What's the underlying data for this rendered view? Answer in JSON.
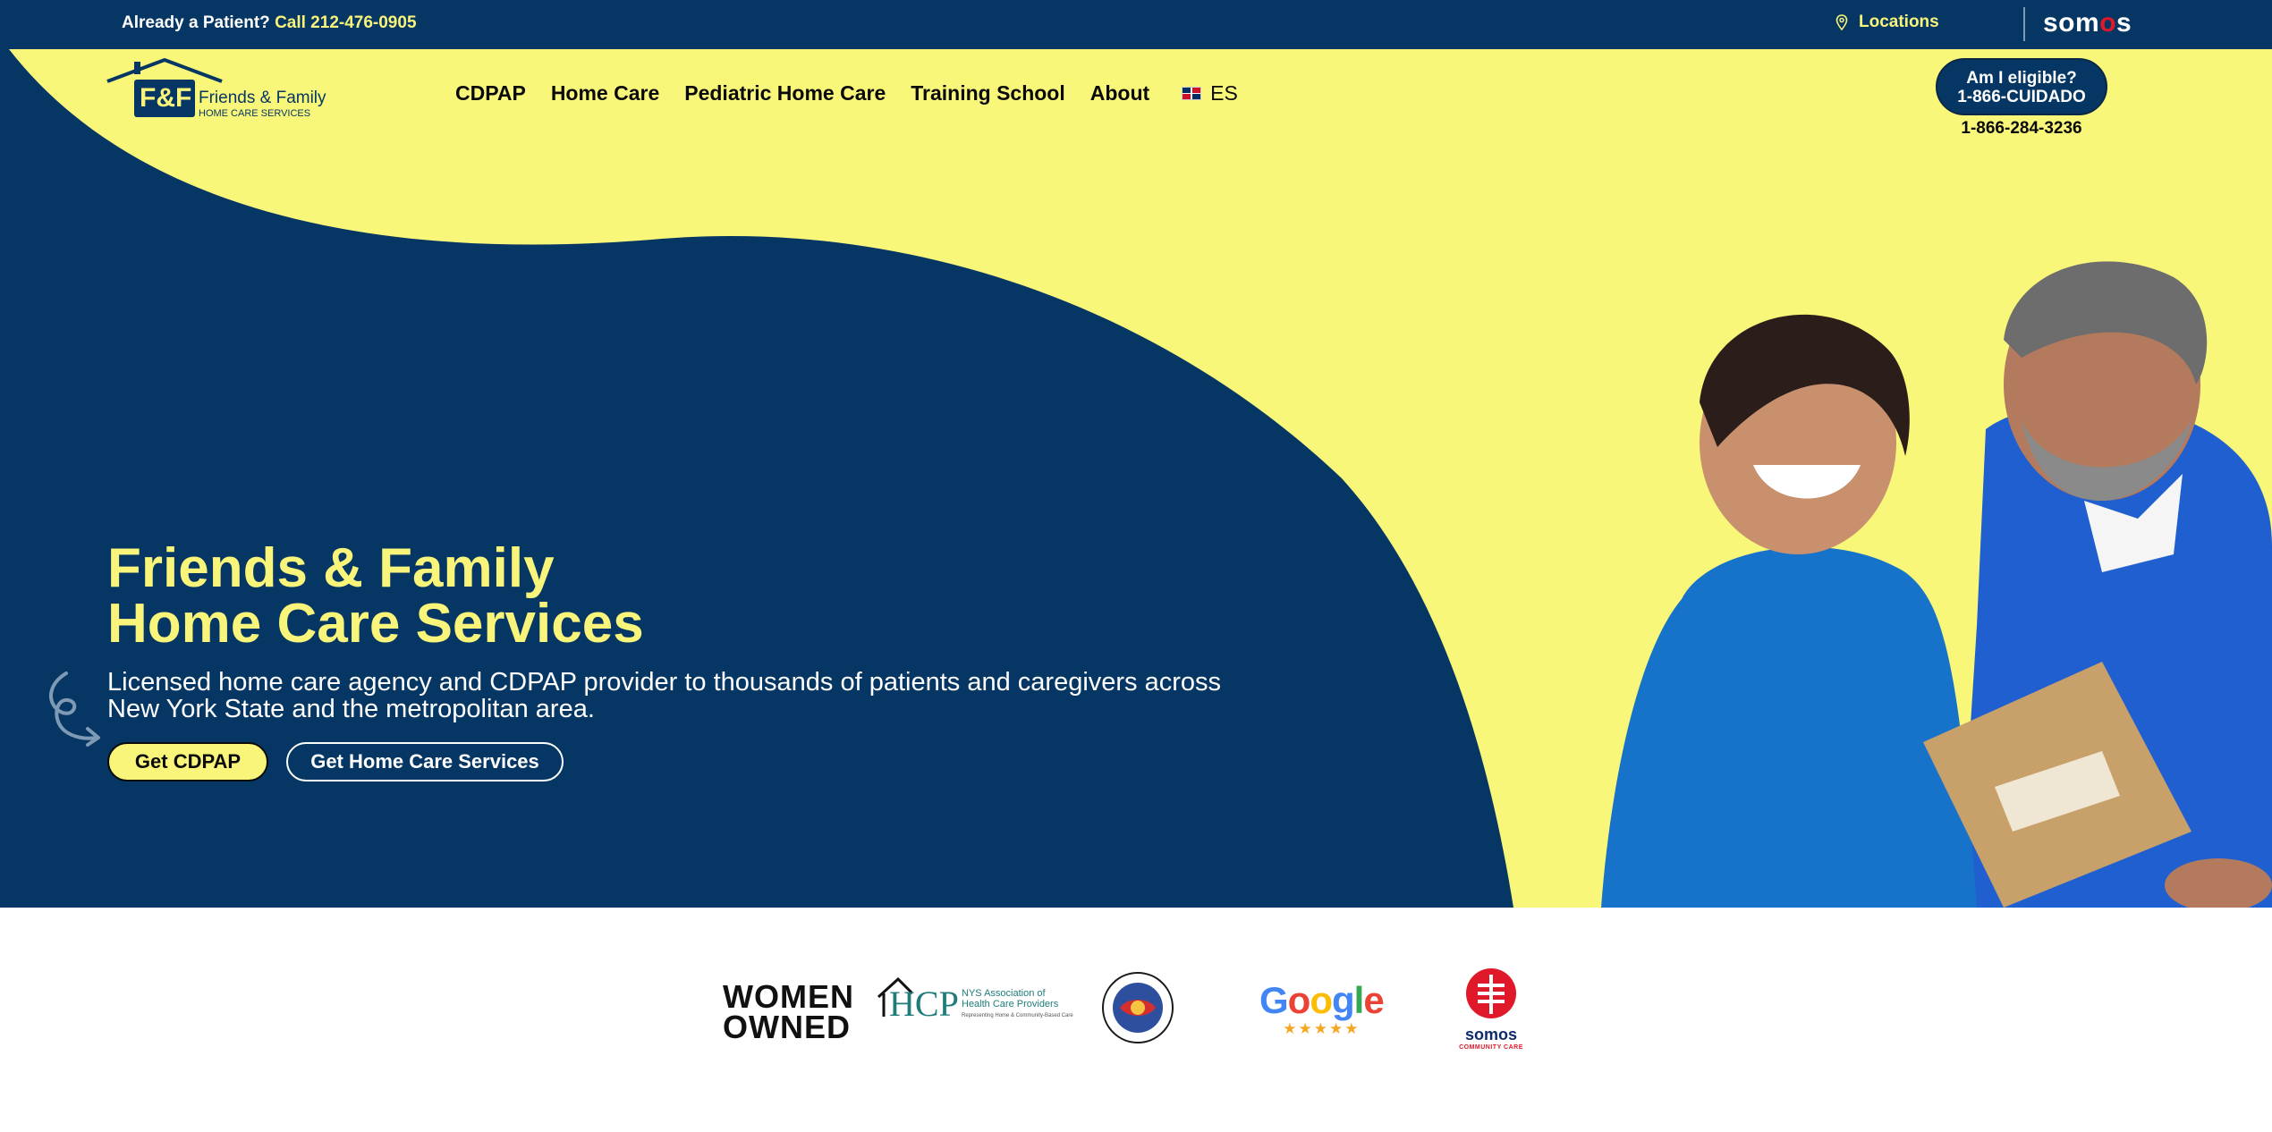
{
  "topbar": {
    "patient_text": "Already a Patient?",
    "patient_phone": "Call 212-476-0905",
    "locations_label": "Locations",
    "somos_brand_pre": "som",
    "somos_brand_o": "o",
    "somos_brand_post": "s"
  },
  "logo": {
    "monogram": "F&F",
    "name": "Friends & Family",
    "tagline": "HOME CARE SERVICES"
  },
  "nav": {
    "items": [
      "CDPAP",
      "Home Care",
      "Pediatric Home Care",
      "Training School",
      "About"
    ],
    "language": "ES"
  },
  "cta": {
    "eligible_line1": "Am I eligible?",
    "eligible_line2": "1-866-CUIDADO",
    "eligible_phone": "1-866-284-3236"
  },
  "hero": {
    "title_line1": "Friends & Family",
    "title_line2": "Home Care Services",
    "subtitle": "Licensed home care agency and CDPAP provider to thousands of patients and caregivers across New York State and the metropolitan area.",
    "primary_button": "Get CDPAP",
    "secondary_button": "Get Home Care Services"
  },
  "badges": {
    "women_line1": "WOMEN",
    "women_line2": "OWNED",
    "hcp_big": "HCP",
    "hcp_small1": "NYS Association of",
    "hcp_small2": "Health Care Providers",
    "hcp_small3": "Representing Home & Community-Based Care",
    "google_g1": "G",
    "google_o1": "o",
    "google_o2": "o",
    "google_g2": "g",
    "google_l": "l",
    "google_e": "e",
    "google_stars": "★★★★★",
    "somos_name": "somos",
    "somos_tag": "COMMUNITY CARE"
  },
  "colors": {
    "navy": "#063764",
    "yellow": "#f9f77a",
    "accent_yellow": "#f9f47a",
    "white": "#ffffff"
  },
  "icons": [
    "location-pin-icon",
    "flag-dominican-republic-icon",
    "curly-arrow-doodle-icon"
  ]
}
